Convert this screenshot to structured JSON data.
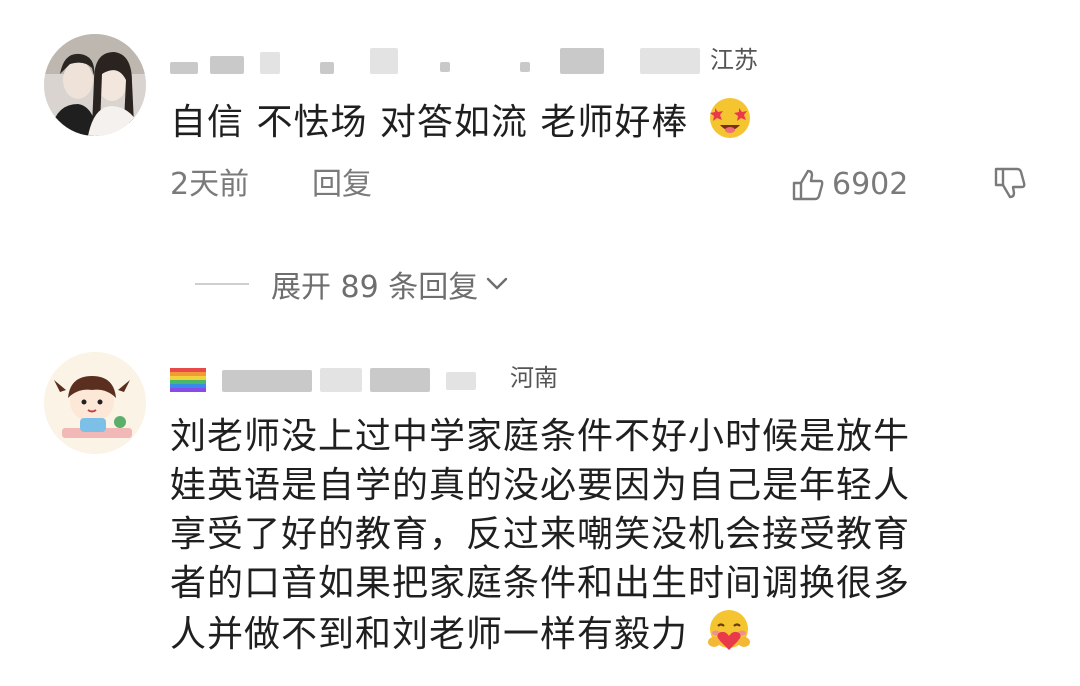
{
  "comments": [
    {
      "region": "江苏",
      "text": "自信 不怯场 对答如流 老师好棒",
      "emoji_icon": "star-struck-emoji",
      "time": "2天前",
      "reply_label": "回复",
      "likes": "6902",
      "expand_label": "展开 89 条回复"
    },
    {
      "region": "河南",
      "lines": [
        "刘老师没上过中学家庭条件不好小时候是放牛",
        "娃英语是自学的真的没必要因为自己是年轻人",
        "享受了好的教育，反过来嘲笑没机会接受教育",
        "者的口音如果把家庭条件和出生时间调换很多",
        "人并做不到和刘老师一样有毅力"
      ],
      "emoji_icon": "hugging-heart-emoji"
    }
  ],
  "icons": {
    "like": "thumbs-up-icon",
    "dislike": "thumbs-down-icon",
    "expand": "chevron-down-icon"
  },
  "colors": {
    "text": "#1f1f1f",
    "secondary": "#7a7a7a"
  }
}
